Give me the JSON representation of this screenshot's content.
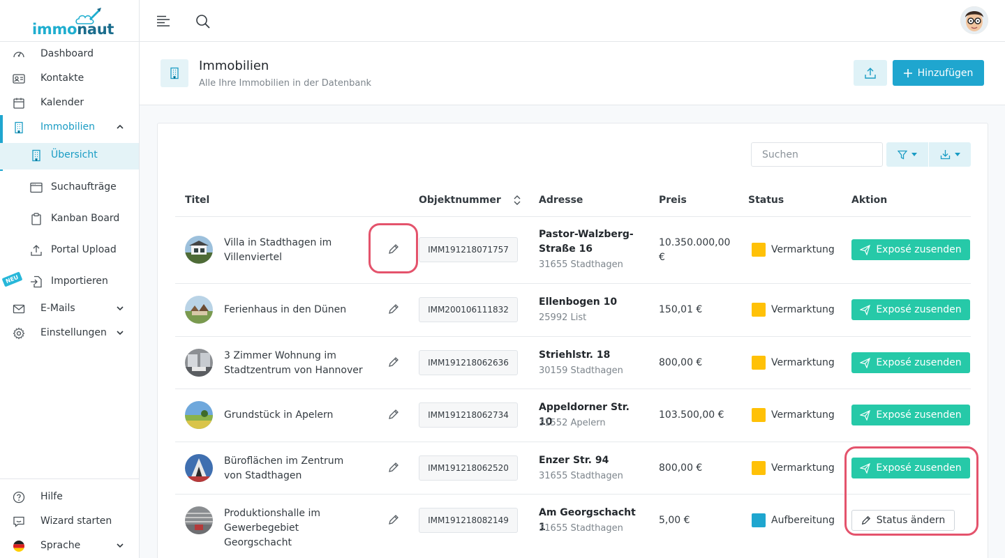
{
  "app": {
    "logo_part1": "immo",
    "logo_part2": "naut"
  },
  "sidebar": {
    "items": [
      {
        "label": "Dashboard"
      },
      {
        "label": "Kontakte"
      },
      {
        "label": "Kalender"
      },
      {
        "label": "Immobilien"
      },
      {
        "label": "Übersicht"
      },
      {
        "label": "Suchaufträge"
      },
      {
        "label": "Kanban Board"
      },
      {
        "label": "Portal Upload"
      },
      {
        "label": "Importieren"
      },
      {
        "label": "E-Mails"
      },
      {
        "label": "Einstellungen"
      }
    ],
    "new_badge": "NEU",
    "bottom": [
      {
        "label": "Hilfe"
      },
      {
        "label": "Wizard starten"
      },
      {
        "label": "Sprache"
      }
    ]
  },
  "page": {
    "title": "Immobilien",
    "subtitle": "Alle Ihre Immobilien in der Datenbank",
    "add_label": "Hinzufügen"
  },
  "toolbar": {
    "search_placeholder": "Suchen"
  },
  "table": {
    "headers": {
      "title": "Titel",
      "objnr": "Objektnummer",
      "address": "Adresse",
      "price": "Preis",
      "status": "Status",
      "action": "Aktion"
    },
    "rows": [
      {
        "title": "Villa in Stadthagen im Villenviertel",
        "objnr": "IMM191218071757",
        "street": "Pastor-Walzberg-Straße 16",
        "city": "31655 Stadthagen",
        "price": "10.350.000,00 €",
        "status": "Vermarktung",
        "status_color": "#ffc107",
        "action": "Exposé zusenden"
      },
      {
        "title": "Ferienhaus in den Dünen",
        "objnr": "IMM200106111832",
        "street": "Ellenbogen 10",
        "city": "25992 List",
        "price": "150,01 €",
        "status": "Vermarktung",
        "status_color": "#ffc107",
        "action": "Exposé zusenden"
      },
      {
        "title": "3 Zimmer Wohnung im Stadtzentrum von Hannover",
        "objnr": "IMM191218062636",
        "street": "Striehlstr. 18",
        "city": "30159 Stadthagen",
        "price": "800,00 €",
        "status": "Vermarktung",
        "status_color": "#ffc107",
        "action": "Exposé zusenden"
      },
      {
        "title": "Grundstück in Apelern",
        "objnr": "IMM191218062734",
        "street": "Appeldorner Str. 10",
        "city": "31552 Apelern",
        "price": "103.500,00 €",
        "status": "Vermarktung",
        "status_color": "#ffc107",
        "action": "Exposé zusenden"
      },
      {
        "title": "Büroflächen im Zentrum von Stadthagen",
        "objnr": "IMM191218062520",
        "street": "Enzer Str. 94",
        "city": "31655 Stadthagen",
        "price": "800,00 €",
        "status": "Vermarktung",
        "status_color": "#ffc107",
        "action": "Exposé zusenden"
      },
      {
        "title": "Produktionshalle im Gewerbegebiet Georgschacht",
        "objnr": "IMM191218082149",
        "street": "Am Georgschacht 1",
        "city": "31655 Stadthagen",
        "price": "5,00 €",
        "status": "Aufbereitung",
        "status_color": "#1fa6cf",
        "action": "Status ändern"
      }
    ]
  },
  "colors": {
    "accent": "#1fa6cf",
    "success": "#26c9a8",
    "highlight": "#e4536c"
  }
}
